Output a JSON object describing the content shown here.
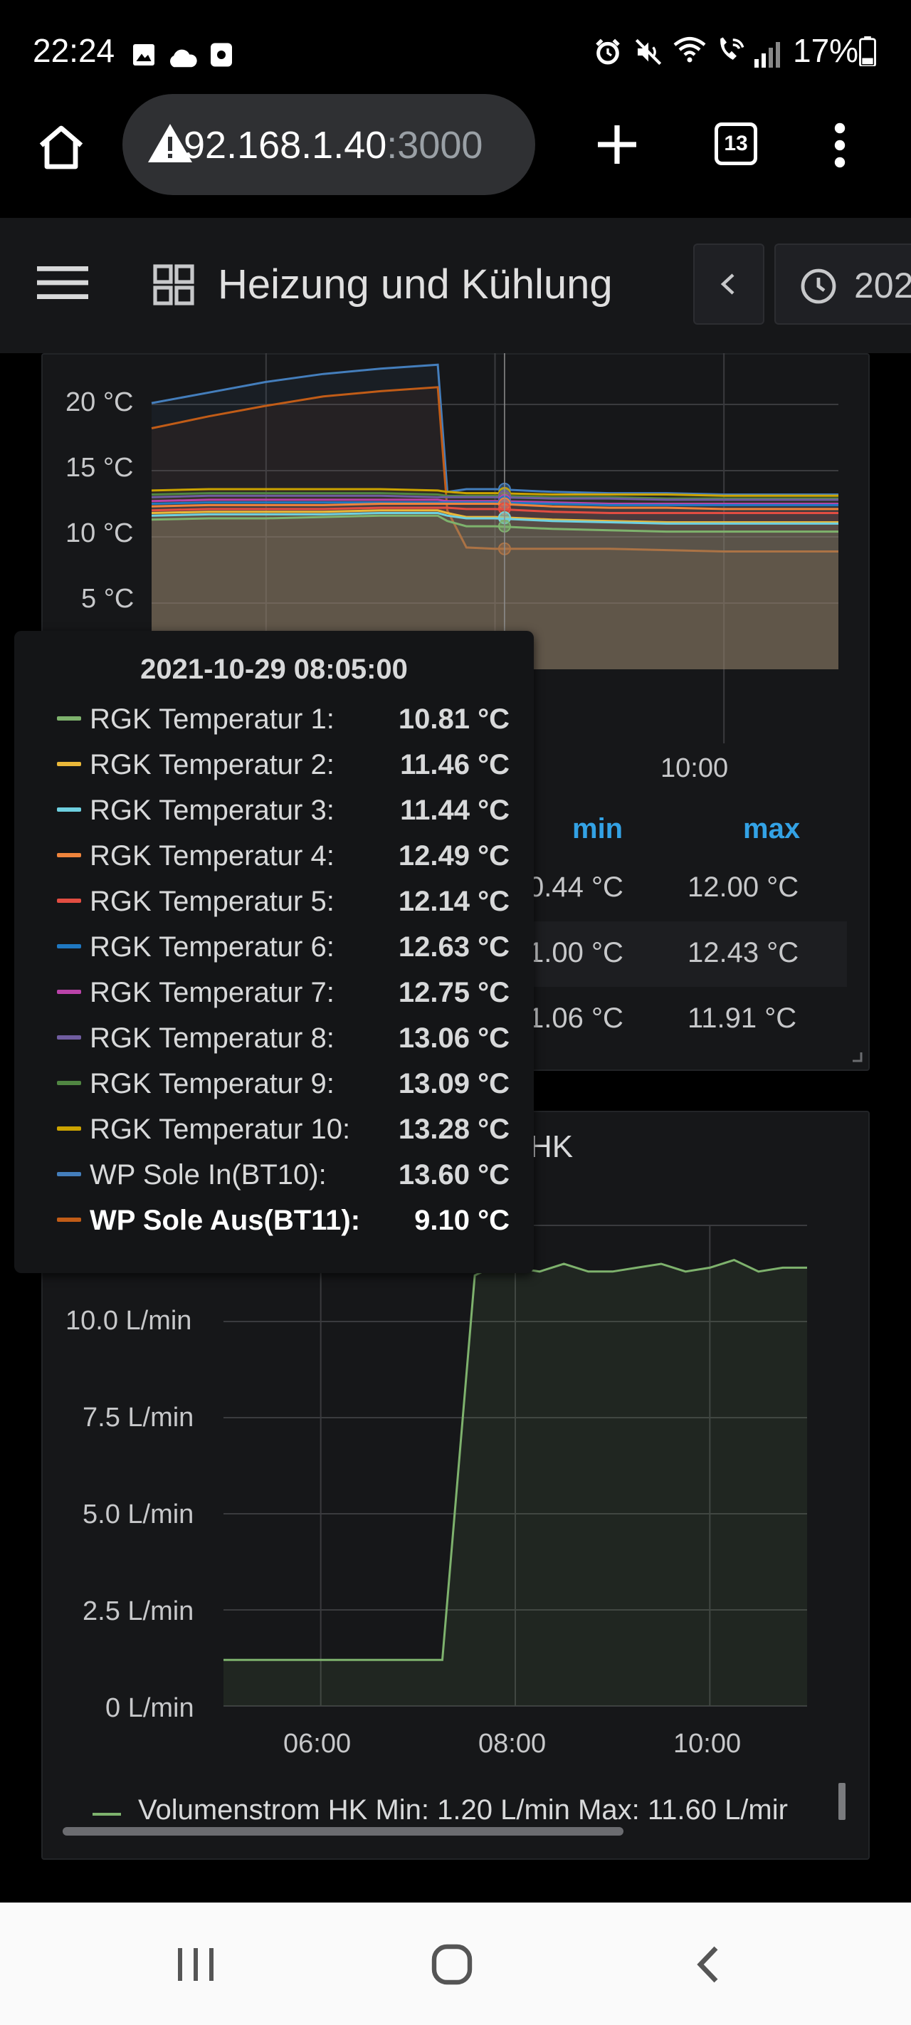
{
  "status_bar": {
    "time": "22:24",
    "battery": "17%",
    "icons": [
      "gallery-icon",
      "cloud-icon",
      "screenshot-icon",
      "alarm-icon",
      "mute-icon",
      "wifi-icon",
      "wifi-call-icon",
      "signal-icon",
      "battery-icon"
    ]
  },
  "browser": {
    "url_host": "92.168.1.40",
    "url_port": ":3000",
    "tab_count": "13"
  },
  "dashboard": {
    "title": "Heizung und Kühlung",
    "time_picker": "202"
  },
  "temp_panel": {
    "y_ticks": [
      "20 °C",
      "15 °C",
      "10 °C",
      "5 °C"
    ],
    "x_ticks": [
      "10:00"
    ],
    "legend_headers": {
      "min": "min",
      "max": "max"
    },
    "legend_rows": [
      {
        "min": "0.44 °C",
        "max": "12.00 °C"
      },
      {
        "min": "1.00 °C",
        "max": "12.43 °C"
      },
      {
        "min": "1.06 °C",
        "max": "11.91 °C"
      }
    ]
  },
  "tooltip": {
    "time": "2021-10-29 08:05:00",
    "rows": [
      {
        "name": "RGK Temperatur 1:",
        "value": "10.81 °C",
        "color": "#7eb26d"
      },
      {
        "name": "RGK Temperatur 2:",
        "value": "11.46 °C",
        "color": "#eab839"
      },
      {
        "name": "RGK Temperatur 3:",
        "value": "11.44 °C",
        "color": "#6ed0e0"
      },
      {
        "name": "RGK Temperatur 4:",
        "value": "12.49 °C",
        "color": "#ef843c"
      },
      {
        "name": "RGK Temperatur 5:",
        "value": "12.14 °C",
        "color": "#e24d42"
      },
      {
        "name": "RGK Temperatur 6:",
        "value": "12.63 °C",
        "color": "#1f78c1"
      },
      {
        "name": "RGK Temperatur 7:",
        "value": "12.75 °C",
        "color": "#ba43a9"
      },
      {
        "name": "RGK Temperatur 8:",
        "value": "13.06 °C",
        "color": "#705da0"
      },
      {
        "name": "RGK Temperatur 9:",
        "value": "13.09 °C",
        "color": "#508642"
      },
      {
        "name": "RGK Temperatur 10:",
        "value": "13.28 °C",
        "color": "#cca300"
      },
      {
        "name": "WP Sole In(BT10):",
        "value": "13.60 °C",
        "color": "#447ebc"
      },
      {
        "name": "WP Sole Aus(BT11):",
        "value": "9.10 °C",
        "color": "#c15c17"
      }
    ]
  },
  "flow_panel": {
    "title_partial": "HK",
    "legend": "Volumenstrom HK  Min: 1.20 L/min  Max: 11.60 L/mir",
    "legend_color": "#7eb26d"
  },
  "chart_data": [
    {
      "type": "line",
      "ylabel": "",
      "ylim": [
        0,
        23
      ],
      "y_unit": "°C",
      "x": [
        "05:00",
        "05:30",
        "06:00",
        "06:30",
        "07:00",
        "07:30",
        "07:35",
        "07:45",
        "08:00",
        "08:30",
        "09:00",
        "09:30",
        "10:00",
        "10:30",
        "11:00"
      ],
      "series": [
        {
          "name": "WP Sole In(BT10)",
          "color": "#447ebc",
          "values": [
            20.1,
            20.9,
            21.7,
            22.3,
            22.7,
            23.0,
            13.4,
            13.6,
            13.6,
            13.4,
            13.3,
            13.3,
            13.2,
            13.2,
            13.2
          ]
        },
        {
          "name": "WP Sole Aus(BT11)",
          "color": "#c15c17",
          "values": [
            18.2,
            19.1,
            19.9,
            20.6,
            21.0,
            21.3,
            12.0,
            9.2,
            9.1,
            9.1,
            9.1,
            9.0,
            8.9,
            8.9,
            8.9
          ]
        },
        {
          "name": "RGK Temperatur 10",
          "color": "#cca300",
          "values": [
            13.5,
            13.6,
            13.6,
            13.6,
            13.6,
            13.5,
            13.4,
            13.3,
            13.3,
            13.2,
            13.2,
            13.2,
            13.1,
            13.1,
            13.1
          ]
        },
        {
          "name": "RGK Temperatur 9",
          "color": "#508642",
          "values": [
            13.2,
            13.3,
            13.3,
            13.3,
            13.3,
            13.2,
            13.1,
            13.1,
            13.1,
            13.0,
            13.0,
            12.9,
            12.9,
            12.9,
            12.9
          ]
        },
        {
          "name": "RGK Temperatur 8",
          "color": "#705da0",
          "values": [
            13.0,
            13.1,
            13.1,
            13.1,
            13.1,
            13.0,
            13.0,
            13.0,
            13.0,
            12.9,
            12.9,
            12.8,
            12.8,
            12.8,
            12.8
          ]
        },
        {
          "name": "RGK Temperatur 7",
          "color": "#ba43a9",
          "values": [
            12.7,
            12.8,
            12.8,
            12.8,
            12.8,
            12.8,
            12.7,
            12.7,
            12.7,
            12.6,
            12.5,
            12.5,
            12.5,
            12.5,
            12.5
          ]
        },
        {
          "name": "RGK Temperatur 6",
          "color": "#1f78c1",
          "values": [
            12.5,
            12.6,
            12.6,
            12.6,
            12.6,
            12.6,
            12.6,
            12.6,
            12.6,
            12.5,
            12.4,
            12.4,
            12.4,
            12.4,
            12.4
          ]
        },
        {
          "name": "RGK Temperatur 4",
          "color": "#ef843c",
          "values": [
            12.3,
            12.4,
            12.4,
            12.4,
            12.5,
            12.5,
            12.5,
            12.5,
            12.5,
            12.3,
            12.2,
            12.2,
            12.1,
            12.1,
            12.1
          ]
        },
        {
          "name": "RGK Temperatur 5",
          "color": "#e24d42",
          "values": [
            12.0,
            12.1,
            12.1,
            12.1,
            12.2,
            12.2,
            12.2,
            12.1,
            12.1,
            11.9,
            11.8,
            11.8,
            11.8,
            11.8,
            11.8
          ]
        },
        {
          "name": "RGK Temperatur 2",
          "color": "#eab839",
          "values": [
            11.8,
            11.9,
            11.9,
            11.9,
            12.0,
            12.0,
            11.8,
            11.5,
            11.5,
            11.3,
            11.2,
            11.1,
            11.1,
            11.1,
            11.1
          ]
        },
        {
          "name": "RGK Temperatur 3",
          "color": "#6ed0e0",
          "values": [
            11.6,
            11.7,
            11.7,
            11.7,
            11.8,
            11.8,
            11.6,
            11.4,
            11.4,
            11.2,
            11.1,
            11.0,
            11.0,
            11.0,
            11.0
          ]
        },
        {
          "name": "RGK Temperatur 1",
          "color": "#7eb26d",
          "values": [
            11.3,
            11.4,
            11.4,
            11.5,
            11.6,
            11.6,
            11.2,
            10.8,
            10.8,
            10.6,
            10.5,
            10.4,
            10.4,
            10.4,
            10.4
          ]
        }
      ]
    },
    {
      "type": "line",
      "ylabel": "",
      "ylim": [
        0,
        12.5
      ],
      "y_ticks": [
        "10.0 L/min",
        "7.5 L/min",
        "5.0 L/min",
        "2.5 L/min",
        "0 L/min"
      ],
      "x_ticks": [
        "06:00",
        "08:00",
        "10:00"
      ],
      "series": [
        {
          "name": "Volumenstrom HK",
          "color": "#7eb26d",
          "x": [
            "05:00",
            "07:15",
            "07:35",
            "07:45",
            "08:00",
            "08:15",
            "08:30",
            "08:45",
            "09:00",
            "09:15",
            "09:30",
            "09:45",
            "10:00",
            "10:15",
            "10:30",
            "10:45",
            "11:00"
          ],
          "values": [
            1.2,
            1.2,
            11.2,
            11.4,
            11.4,
            11.3,
            11.5,
            11.3,
            11.3,
            11.4,
            11.5,
            11.3,
            11.4,
            11.6,
            11.3,
            11.4,
            11.4
          ]
        }
      ]
    }
  ]
}
